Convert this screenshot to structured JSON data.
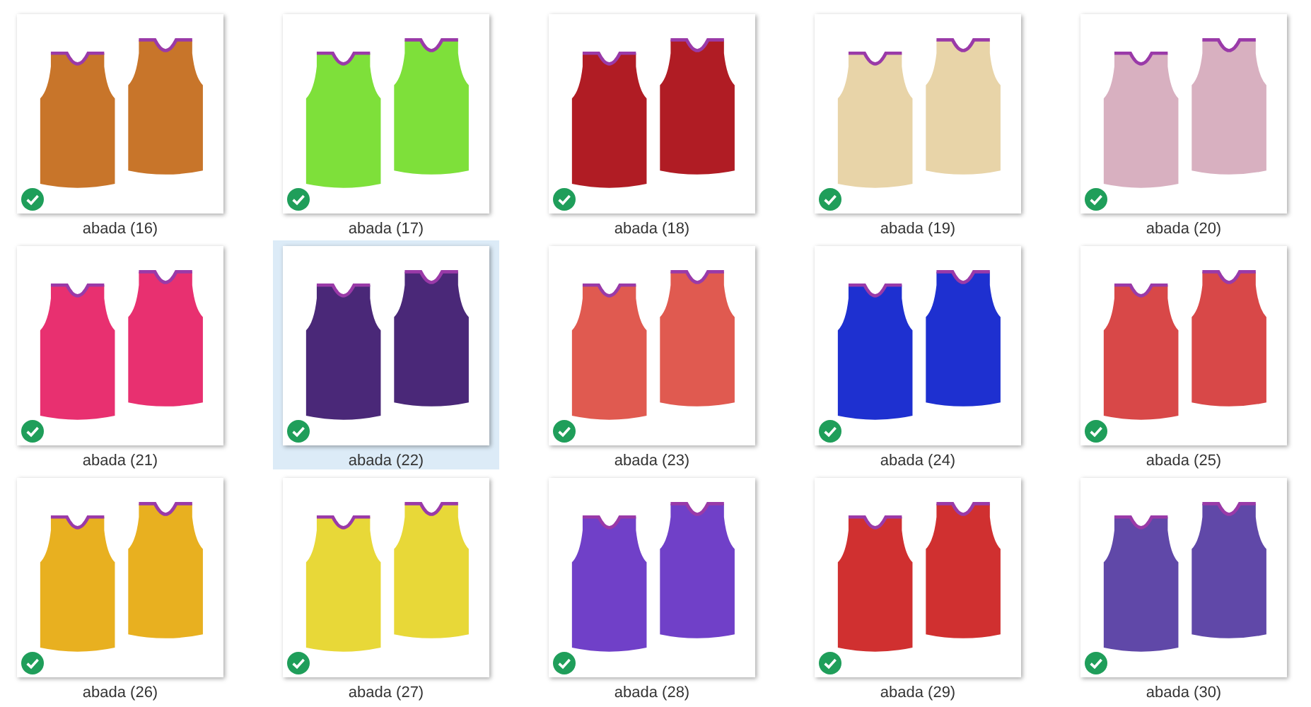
{
  "files": [
    {
      "name": "abada (16)",
      "selected": false,
      "color": "#c8752a"
    },
    {
      "name": "abada (17)",
      "selected": false,
      "color": "#7ee03a"
    },
    {
      "name": "abada (18)",
      "selected": false,
      "color": "#b01c24"
    },
    {
      "name": "abada (19)",
      "selected": false,
      "color": "#e8d4a8"
    },
    {
      "name": "abada (20)",
      "selected": false,
      "color": "#d8b0c0"
    },
    {
      "name": "abada (21)",
      "selected": false,
      "color": "#e83070"
    },
    {
      "name": "abada (22)",
      "selected": true,
      "color": "#4a2878"
    },
    {
      "name": "abada (23)",
      "selected": false,
      "color": "#e05a50"
    },
    {
      "name": "abada (24)",
      "selected": false,
      "color": "#1e30d0"
    },
    {
      "name": "abada (25)",
      "selected": false,
      "color": "#d84848"
    },
    {
      "name": "abada (26)",
      "selected": false,
      "color": "#e8b020"
    },
    {
      "name": "abada (27)",
      "selected": false,
      "color": "#e8d838"
    },
    {
      "name": "abada (28)",
      "selected": false,
      "color": "#7040c8"
    },
    {
      "name": "abada (29)",
      "selected": false,
      "color": "#d03030"
    },
    {
      "name": "abada (30)",
      "selected": false,
      "color": "#6048a8"
    }
  ]
}
